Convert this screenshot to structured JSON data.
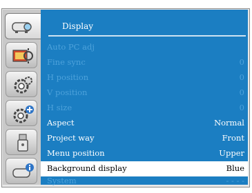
{
  "panel": {
    "title": "Display"
  },
  "menu_items": [
    {
      "label": "Auto PC adj",
      "value": "",
      "enabled": false,
      "selected": false
    },
    {
      "label": "Fine sync",
      "value": "0",
      "enabled": false,
      "selected": false
    },
    {
      "label": "H position",
      "value": "0",
      "enabled": false,
      "selected": false
    },
    {
      "label": "V position",
      "value": "0",
      "enabled": false,
      "selected": false
    },
    {
      "label": "H size",
      "value": "0",
      "enabled": false,
      "selected": false
    },
    {
      "label": "Aspect",
      "value": "Normal",
      "enabled": true,
      "selected": false
    },
    {
      "label": "Project way",
      "value": "Front",
      "enabled": true,
      "selected": false
    },
    {
      "label": "Menu position",
      "value": "Upper",
      "enabled": true,
      "selected": false
    },
    {
      "label": "Background display",
      "value": "Blue",
      "enabled": true,
      "selected": true
    },
    {
      "label": "System",
      "value": "- - - -",
      "enabled": false,
      "selected": false
    }
  ],
  "sidebar_icons": [
    "projector-icon",
    "picture-adjust-icon",
    "settings-gear-icon",
    "expanded-settings-icon",
    "usb-icon",
    "info-icon"
  ],
  "colors": {
    "panel_bg": "#1b7ec2",
    "disabled_text": "#4da2db",
    "selected_bg": "#ffffff"
  }
}
